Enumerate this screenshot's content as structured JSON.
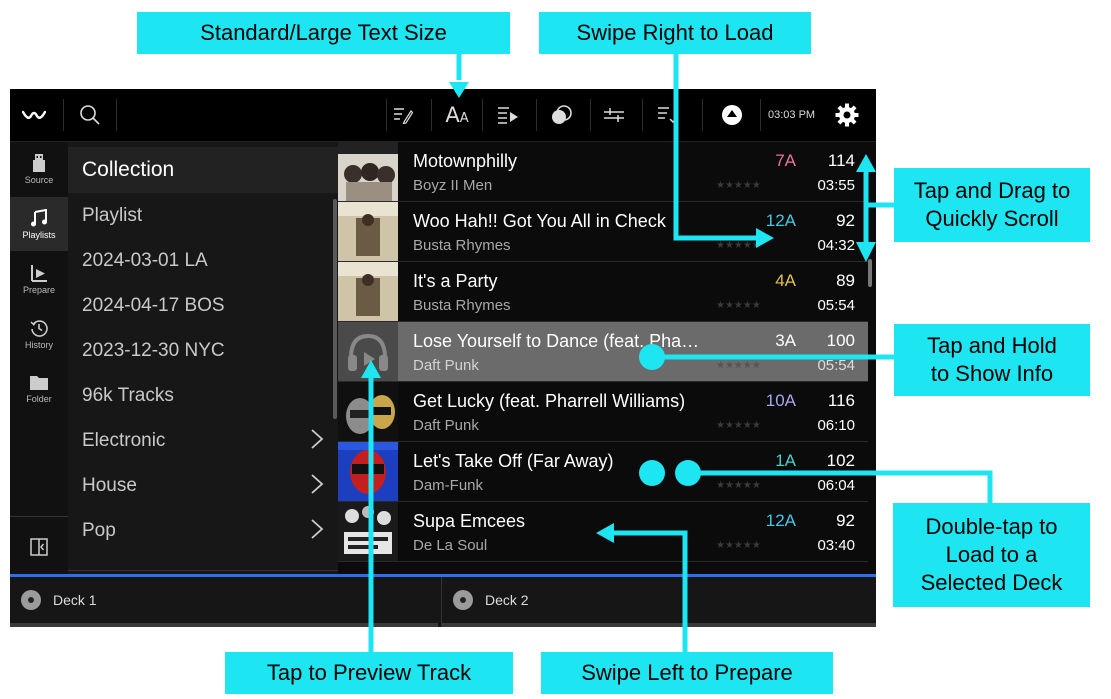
{
  "callouts": {
    "text_size": "Standard/Large Text Size",
    "swipe_right": "Swipe Right to Load",
    "tap_drag": "Tap and Drag to Quickly Scroll",
    "tap_hold": "Tap and Hold to Show Info",
    "double_tap": "Double-tap to Load to a Selected Deck",
    "preview": "Tap to Preview Track",
    "swipe_left": "Swipe Left to Prepare"
  },
  "topbar": {
    "time": "03:03 PM",
    "text_size_glyph": "AA"
  },
  "sidebar": {
    "items": [
      {
        "label": "Source",
        "icon": "usb-icon"
      },
      {
        "label": "Playlists",
        "icon": "music-note-icon"
      },
      {
        "label": "Prepare",
        "icon": "prepare-icon"
      },
      {
        "label": "History",
        "icon": "history-icon"
      },
      {
        "label": "Folder",
        "icon": "folder-icon"
      }
    ],
    "active": "Playlists"
  },
  "crates": [
    {
      "label": "Collection"
    },
    {
      "label": "Playlist"
    },
    {
      "label": "2024-03-01 LA"
    },
    {
      "label": "2024-04-17 BOS"
    },
    {
      "label": "2023-12-30 NYC"
    },
    {
      "label": "96k Tracks"
    },
    {
      "label": "Electronic",
      "chevron": "›"
    },
    {
      "label": "House",
      "chevron": "›"
    },
    {
      "label": "Pop",
      "chevron": "›"
    }
  ],
  "tracks": [
    {
      "title": "Motownphilly",
      "artist": "Boyz II Men",
      "key": "7A",
      "key_color": "#e8769a",
      "bpm": "114",
      "length": "03:55",
      "stars": "★★★★★"
    },
    {
      "title": "Woo Hah!! Got You All in Check",
      "artist": "Busta Rhymes",
      "key": "12A",
      "key_color": "#42c8e6",
      "bpm": "92",
      "length": "04:32",
      "stars": "★★★★★"
    },
    {
      "title": "It's a Party",
      "artist": "Busta Rhymes",
      "key": "4A",
      "key_color": "#e0c348",
      "bpm": "89",
      "length": "05:54",
      "stars": "★★★★★"
    },
    {
      "title": "Lose Yourself to Dance (feat. Pha…",
      "artist": "Daft Punk",
      "key": "3A",
      "key_color": "#ffffff",
      "bpm": "100",
      "length": "05:54",
      "stars": "★★★★★"
    },
    {
      "title": "Get Lucky (feat. Pharrell Williams)",
      "artist": "Daft Punk",
      "key": "10A",
      "key_color": "#a8a6ee",
      "bpm": "116",
      "length": "06:10",
      "stars": "★★★★★"
    },
    {
      "title": "Let's Take Off (Far Away)",
      "artist": "Dam-Funk",
      "key": "1A",
      "key_color": "#42d2c6",
      "bpm": "102",
      "length": "06:04",
      "stars": "★★★★★"
    },
    {
      "title": "Supa Emcees",
      "artist": "De La Soul",
      "key": "12A",
      "key_color": "#42c8e6",
      "bpm": "92",
      "length": "03:40",
      "stars": "★★★★★"
    }
  ],
  "decks": {
    "deck1": "Deck 1",
    "deck2": "Deck 2"
  },
  "colors": {
    "callout": "#1ee5f2",
    "deck_accent": "#2d6ef0"
  }
}
